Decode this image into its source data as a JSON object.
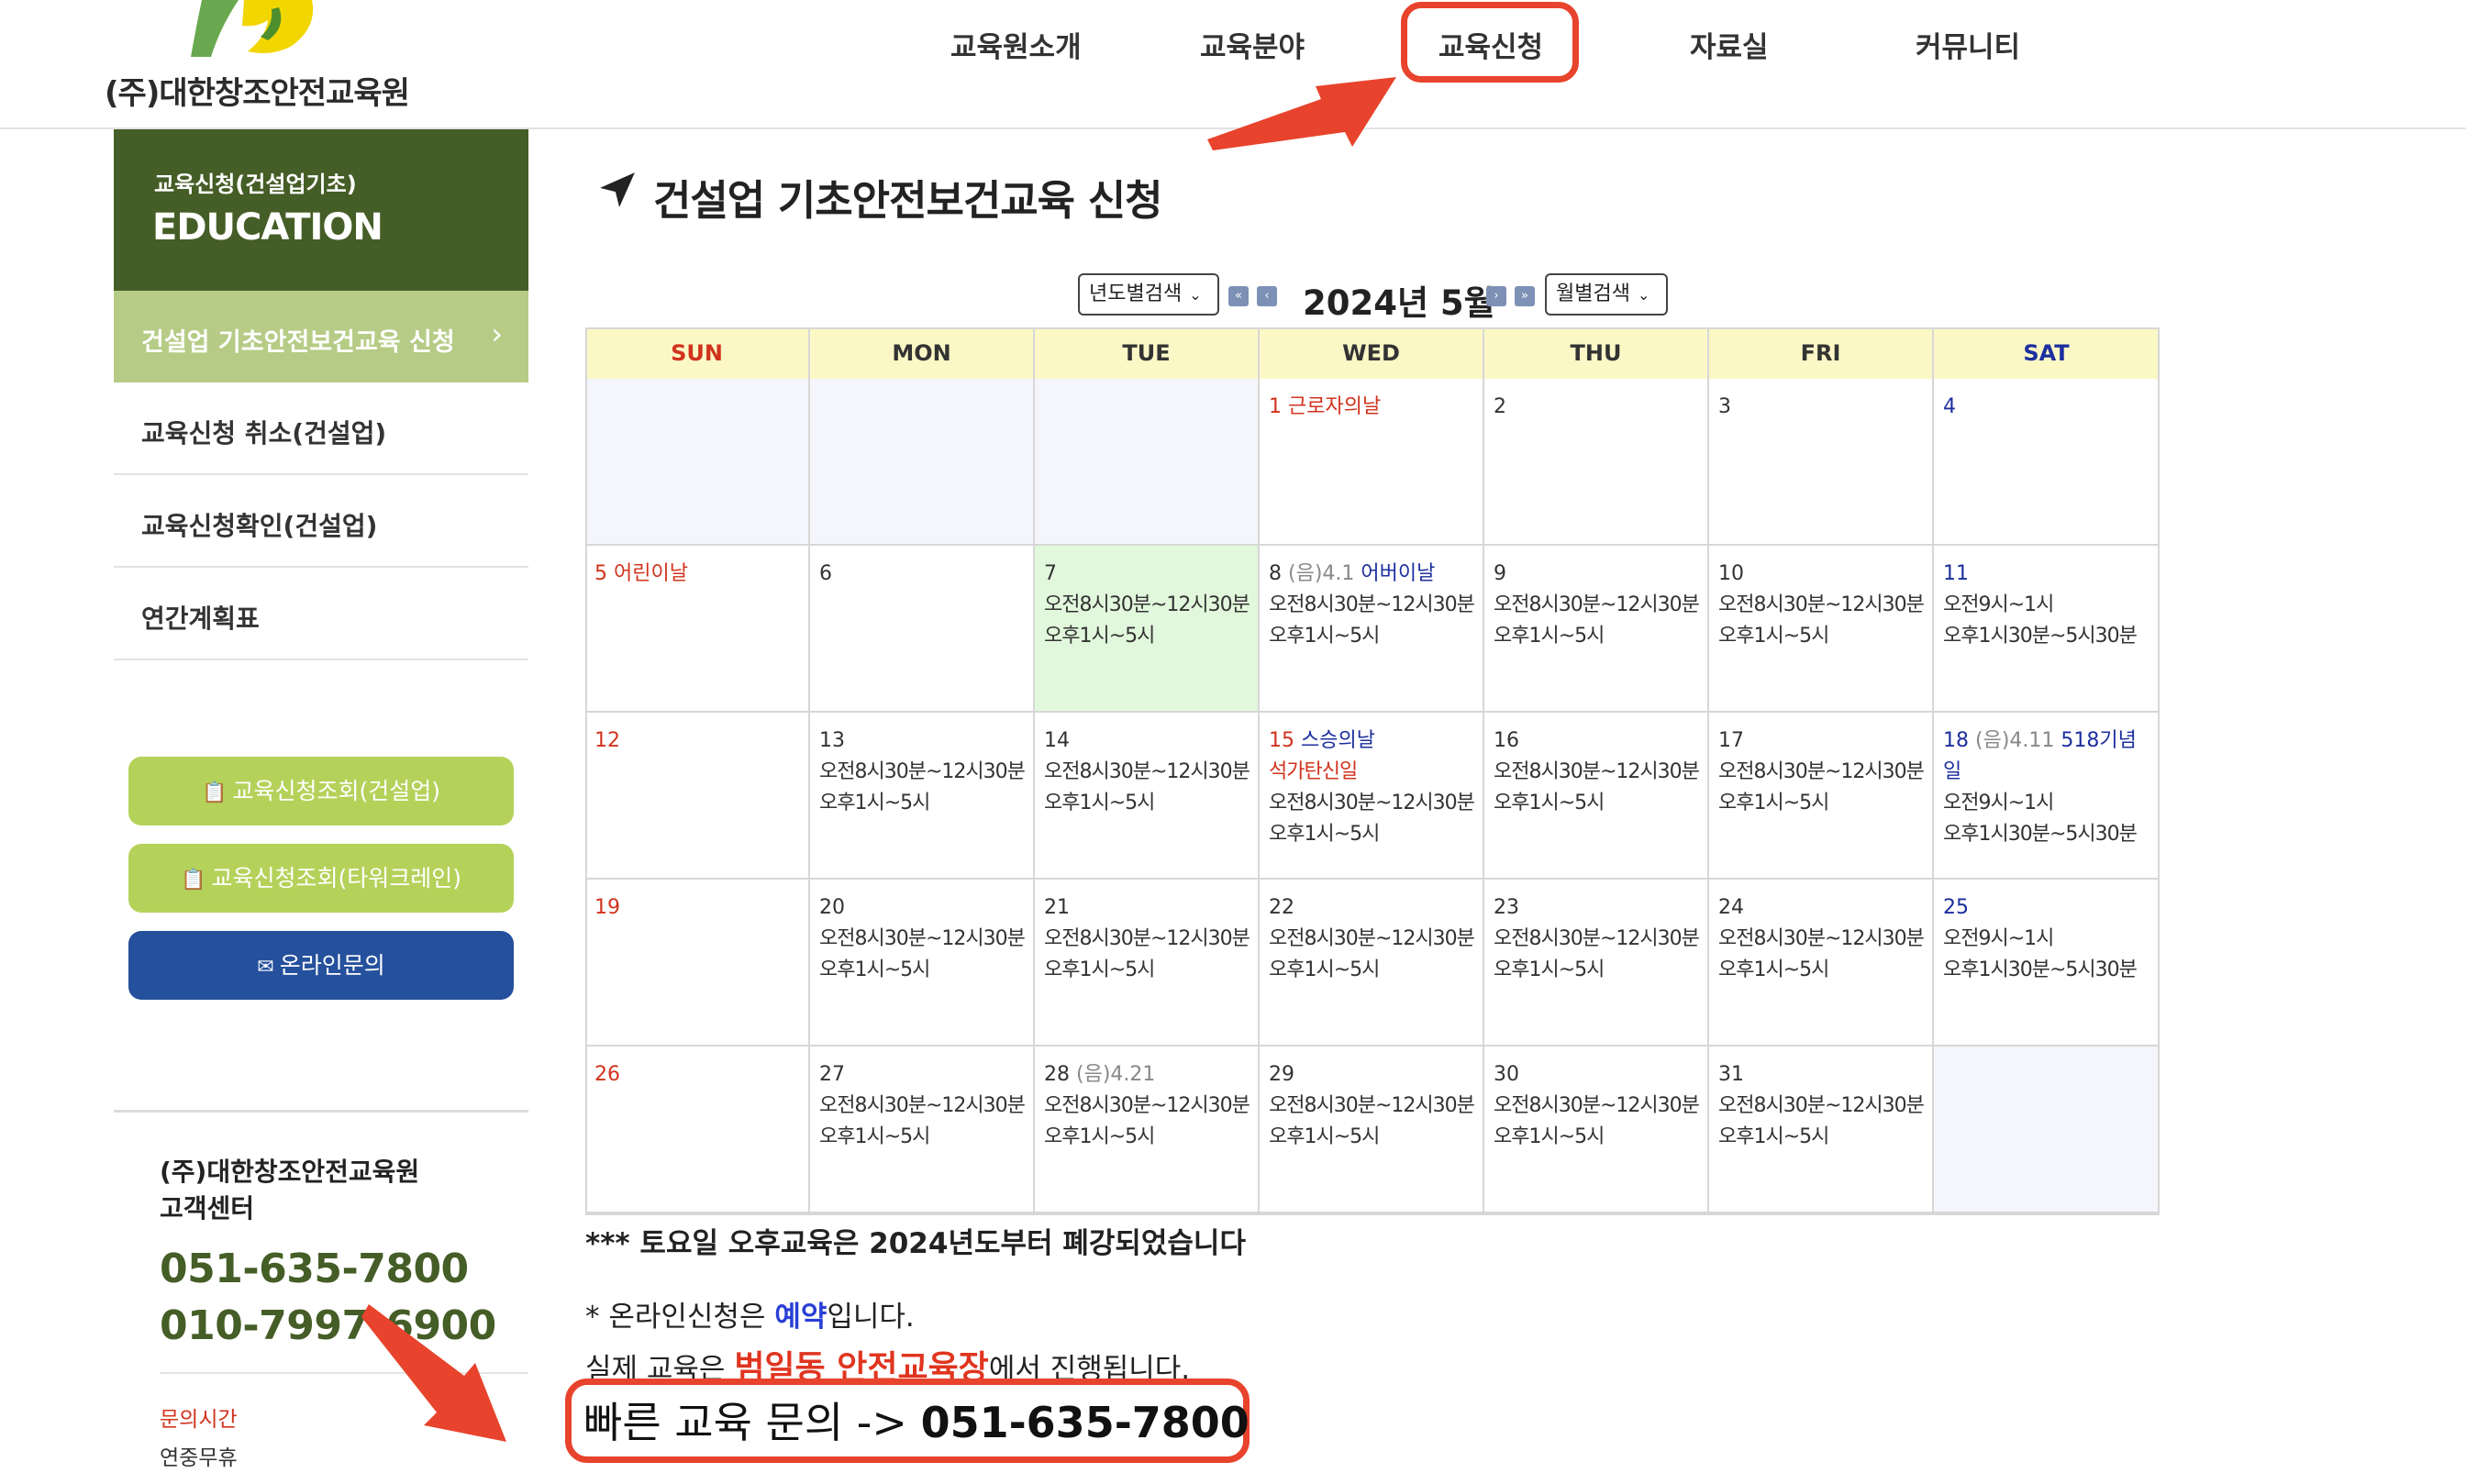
{
  "header": {
    "logo_text": "(주)대한창조안전교육원",
    "nav": [
      {
        "label": "교육원소개"
      },
      {
        "label": "교육분야"
      },
      {
        "label": "교육신청"
      },
      {
        "label": "자료실"
      },
      {
        "label": "커뮤니티"
      }
    ]
  },
  "sidebar": {
    "section_sub": "교육신청(건설업기초)",
    "section_title": "EDUCATION",
    "active_item": "건설업 기초안전보건교육 신청",
    "items": [
      {
        "label": "교육신청 취소(건설업)"
      },
      {
        "label": "교육신청확인(건설업)"
      },
      {
        "label": "연간계획표"
      }
    ],
    "buttons": [
      {
        "label": "교육신청조회(건설업)"
      },
      {
        "label": "교육신청조회(타워크레인)"
      },
      {
        "label": "온라인문의"
      }
    ],
    "contact": {
      "name_line1": "(주)대한창조안전교육원",
      "name_line2": "고객센터",
      "phone1": "051-635-7800",
      "phone2": "010-7997-6900",
      "hours_label": "문의시간",
      "hours_value": "연중무휴"
    }
  },
  "main": {
    "page_title": "건설업 기초안전보건교육 신청",
    "year_select": "년도별검색",
    "month_select": "월별검색",
    "month_title": "2024년 5월",
    "weekdays": [
      "SUN",
      "MON",
      "TUE",
      "WED",
      "THU",
      "FRI",
      "SAT"
    ],
    "time_weekday_am": "오전8시30분~12시30분",
    "time_weekday_pm": "오후1시~5시",
    "time_sat_am": "오전9시~1시",
    "time_sat_pm": "오후1시30분~5시30분",
    "holidays": {
      "d1": "근로자의날",
      "d5": "어린이날",
      "d8_lunar": "(음)4.1",
      "d8_name": "어버이날",
      "d15_name": "스승의날",
      "d15_name2": "석가탄신일",
      "d18_lunar": "(음)4.11",
      "d18_name": "518기념일",
      "d28_lunar": "(음)4.21"
    },
    "notice_saturday": "*** 토요일 오후교육은 2024년도부터 폐강되었습니다",
    "note1_pre": "* 온라인신청은 ",
    "note1_hl": "예약",
    "note1_post": "입니다.",
    "note2_pre": "실제 교육은 ",
    "note2_hl": "범일동 안전교육장",
    "note2_post": "에서 진행됩니다.",
    "quick_label": "빠른 교육 문의 -> ",
    "quick_phone": "051-635-7800"
  },
  "colors": {
    "sidebar_dark": "#455d26",
    "sidebar_active": "#b6cc86",
    "pill_green": "#b4d25a",
    "pill_blue": "#25509c",
    "highlight_red": "#e8432c",
    "header_yellow": "#fbf8c6",
    "today_green": "#e2f8dc"
  }
}
